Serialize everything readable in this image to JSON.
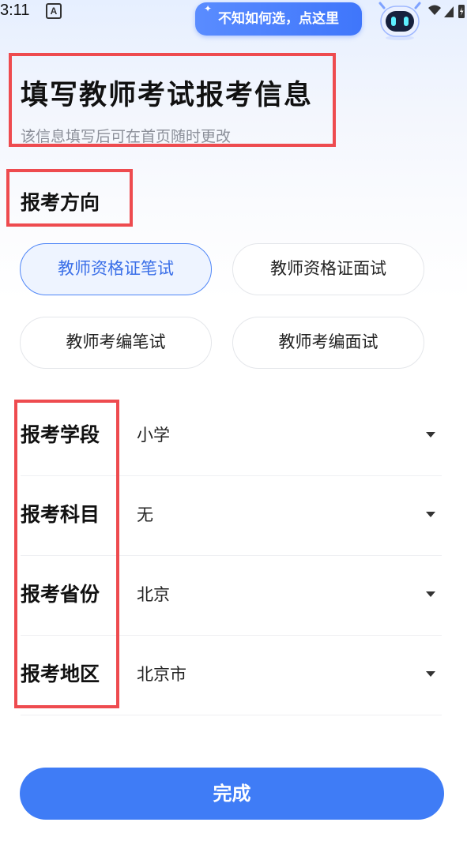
{
  "status_bar": {
    "time": "3:11",
    "a_icon_letter": "A"
  },
  "assistant": {
    "tip": "不知如何选，点这里"
  },
  "header": {
    "title": "填写教师考试报考信息",
    "subtitle": "该信息填写后可在首页随时更改"
  },
  "direction": {
    "label": "报考方向",
    "options": [
      {
        "label": "教师资格证笔试",
        "selected": true
      },
      {
        "label": "教师资格证面试",
        "selected": false
      },
      {
        "label": "教师考编笔试",
        "selected": false
      },
      {
        "label": "教师考编面试",
        "selected": false
      }
    ]
  },
  "form": {
    "rows": [
      {
        "label": "报考学段",
        "value": "小学"
      },
      {
        "label": "报考科目",
        "value": "无"
      },
      {
        "label": "报考省份",
        "value": "北京"
      },
      {
        "label": "报考地区",
        "value": "北京市"
      }
    ]
  },
  "submit_label": "完成",
  "colors": {
    "accent": "#3f7cf6",
    "highlight_box": "#ee4b4f",
    "selected_bg": "#eef4ff"
  }
}
